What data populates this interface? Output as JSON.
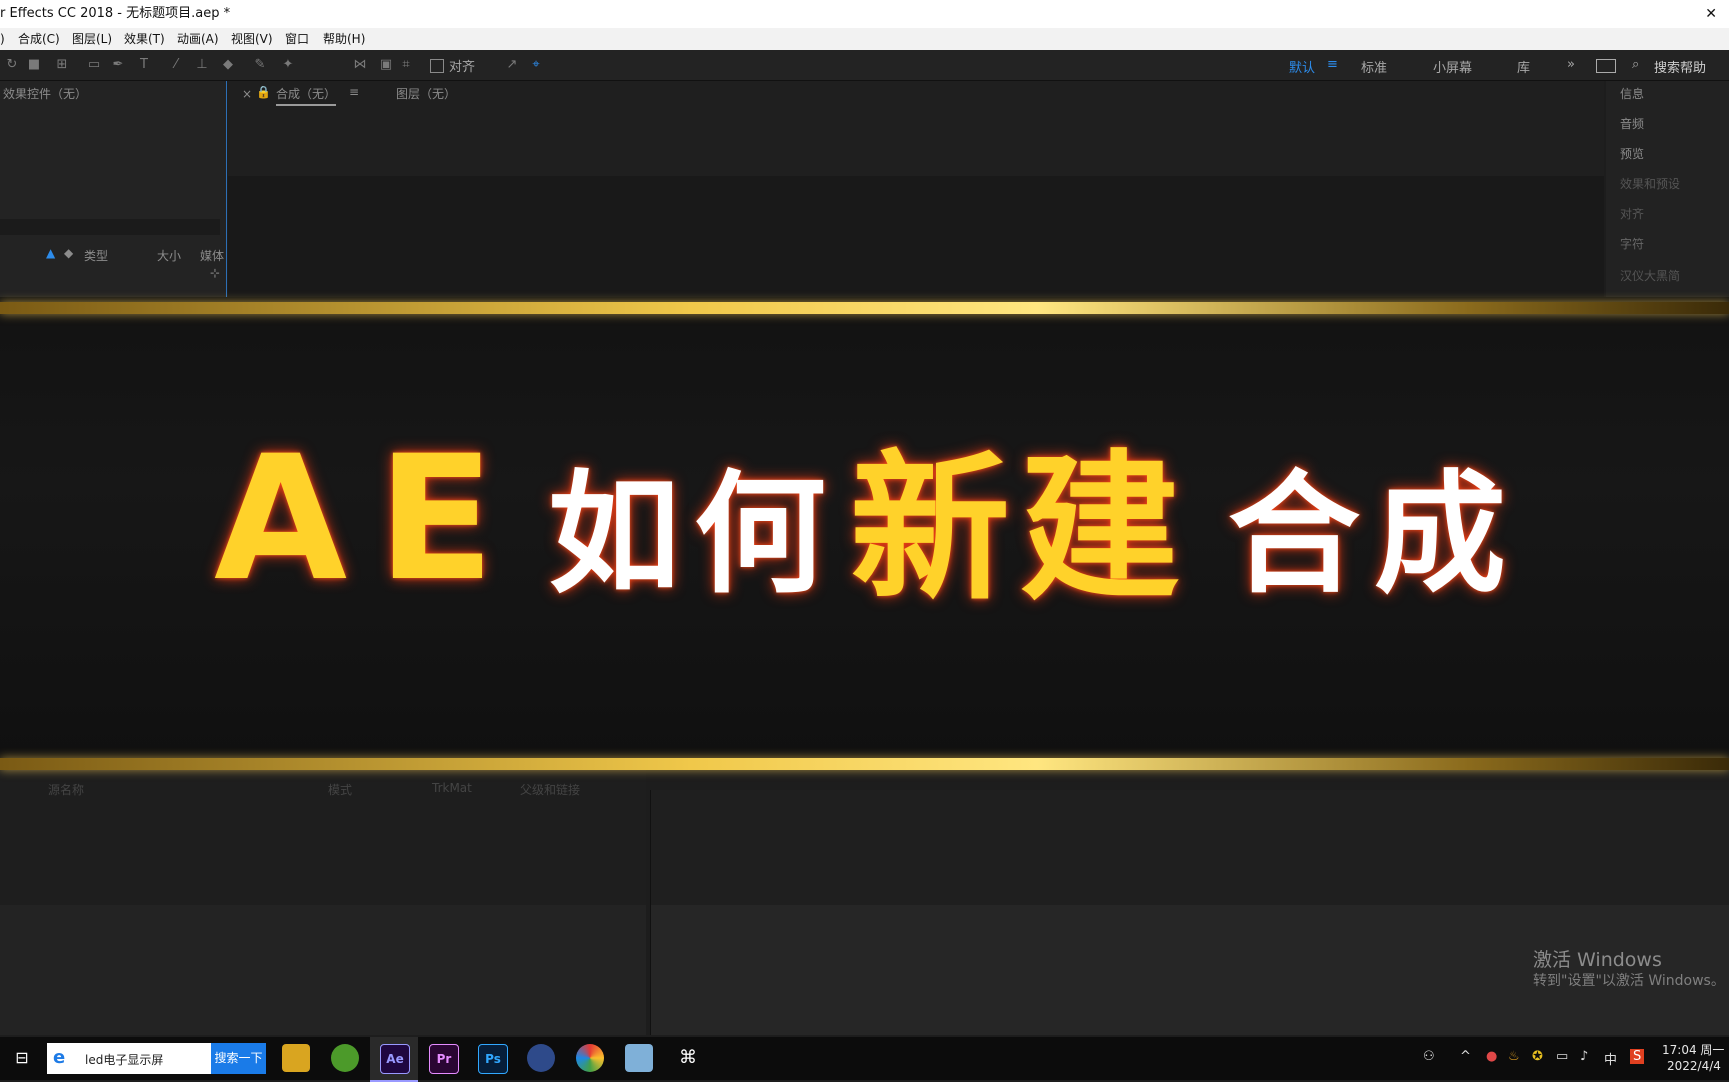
{
  "window": {
    "title": "r Effects CC 2018 - 无标题项目.aep *",
    "close_glyph": "✕"
  },
  "menu": [
    "合成(C)",
    "图层(L)",
    "效果(T)",
    "动画(A)",
    "视图(V)",
    "窗口",
    "帮助(H)"
  ],
  "toolbar": {
    "align_label": "对齐",
    "workspaces": [
      "默认",
      "标准",
      "小屏幕",
      "库"
    ],
    "search_placeholder": "搜索帮助"
  },
  "panels": {
    "effects_controls": "效果控件（无）",
    "composition_tab": "合成（无）",
    "layer_tab": "图层（无）",
    "project_columns": [
      "类型",
      "大小",
      "媒体"
    ],
    "right_panels": [
      "信息",
      "音频",
      "预览",
      "效果和预设",
      "对齐",
      "字符"
    ],
    "font_select": "汉仪大黑简",
    "timeline_columns": [
      "源名称",
      "模式",
      "TrkMat",
      "父级和链接"
    ]
  },
  "banner": {
    "part1": "AE",
    "part2": "如何",
    "part3": "新建",
    "part4": "合成"
  },
  "activation": {
    "line1": "激活 Windows",
    "line2": "转到\"设置\"以激活 Windows。"
  },
  "taskbar": {
    "search_text": "led电子显示屏",
    "search_button": "搜索一下",
    "apps": [
      "Ae",
      "Pr",
      "Ps"
    ],
    "ime": "中",
    "time": "17:04 周一",
    "date": "2022/4/4"
  },
  "colors": {
    "accent_gold": "#ffd22a",
    "ae_purple": "#9999ff",
    "workspace_active": "#2d8ceb"
  }
}
